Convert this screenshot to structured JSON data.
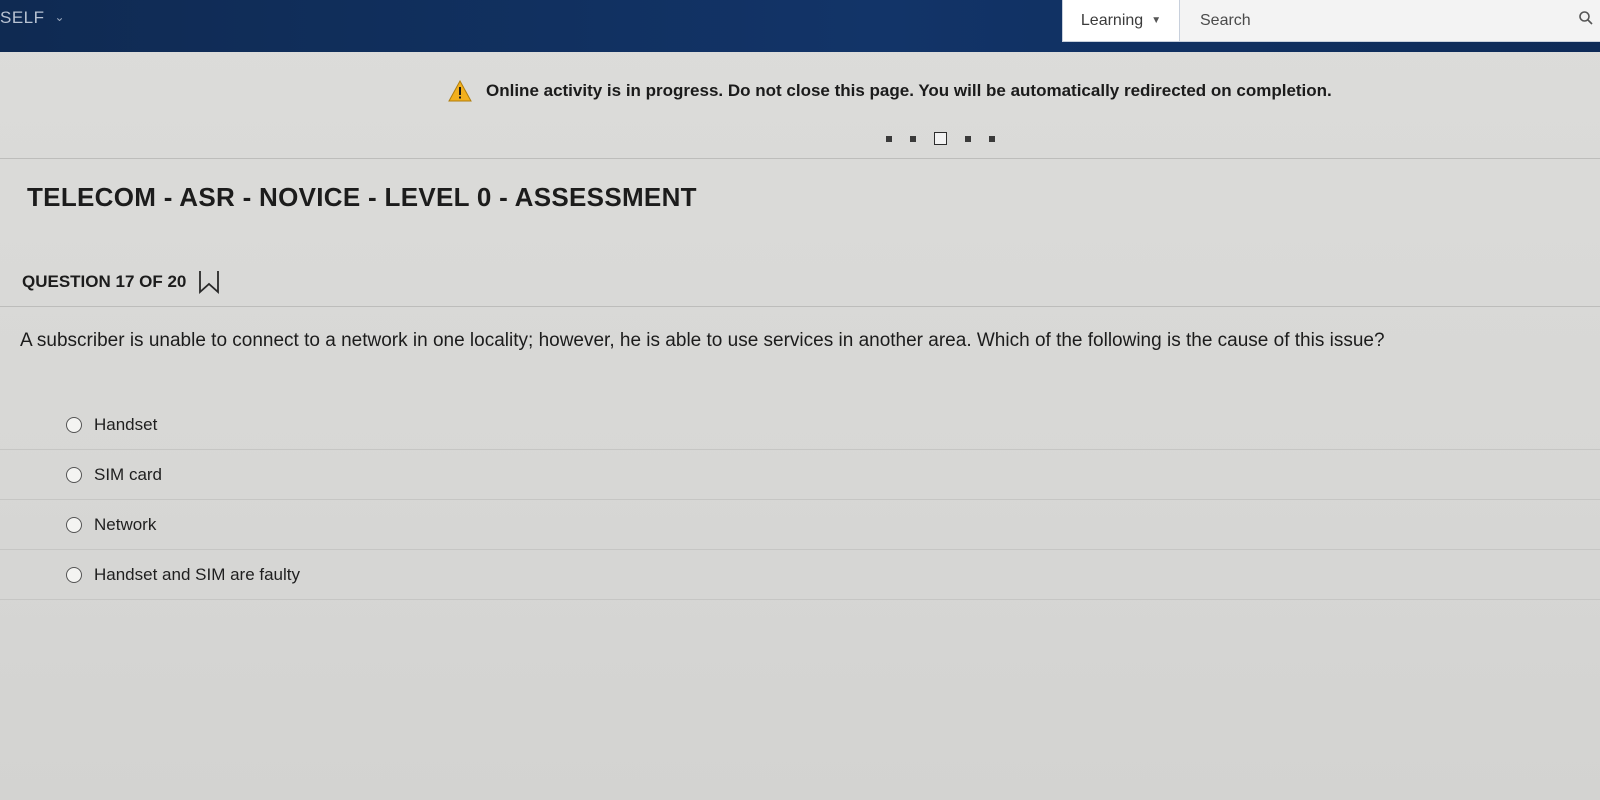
{
  "header": {
    "brand": "SELF",
    "learning_label": "Learning",
    "search_placeholder": "Search"
  },
  "alert": {
    "message": "Online activity is in progress. Do not close this page. You will be automatically redirected on completion."
  },
  "progress": {
    "total_steps": 5,
    "current_step": 3
  },
  "assessment": {
    "title": "TELECOM - ASR - NOVICE - LEVEL 0 - ASSESSMENT",
    "question_number": "QUESTION 17 OF 20",
    "question_text": "A subscriber is unable to connect to a network in one locality; however, he is able to use services in another area. Which of the following is the cause of this issue?",
    "options": [
      {
        "label": "Handset"
      },
      {
        "label": "SIM card"
      },
      {
        "label": "Network"
      },
      {
        "label": "Handset and SIM are faulty"
      }
    ]
  },
  "icons": {
    "brand_dropdown": "chevron-down-icon",
    "learning_dropdown": "caret-down-icon",
    "search": "search-icon",
    "alert": "warning-icon",
    "bookmark": "bookmark-icon"
  },
  "colors": {
    "header_bg": "#123468",
    "warning": "#f2b01e",
    "page_bg": "#d9d9d7"
  }
}
